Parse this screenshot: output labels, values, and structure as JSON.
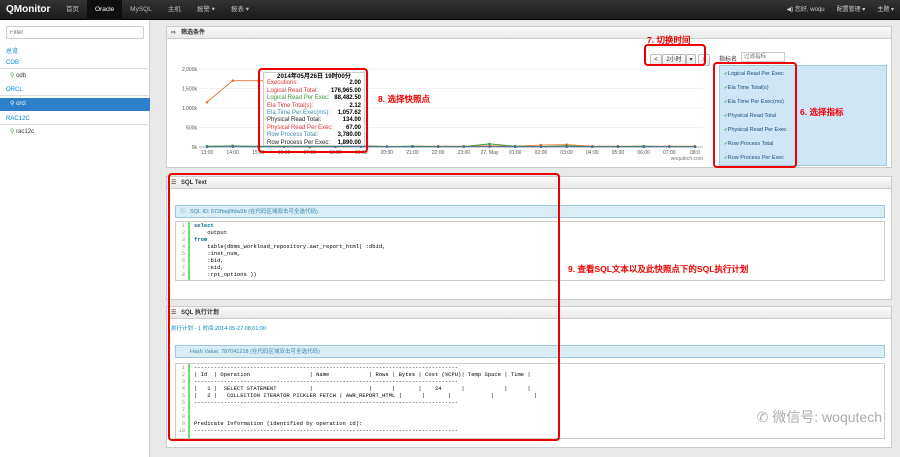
{
  "topbar": {
    "logo": "QMonitor",
    "nav": [
      "首页",
      "Oracle",
      "MySQL",
      "主机",
      "报警 ▾",
      "报表 ▾"
    ],
    "active": "Oracle",
    "right": [
      "◀) 您好, woqu",
      "配置管理 ▾",
      "主题 ▾"
    ]
  },
  "sidebar": {
    "filter_placeholder": "Filter",
    "title": "总览",
    "groups": [
      {
        "name": "COB",
        "items": [
          "odb"
        ]
      },
      {
        "name": "ORCL",
        "items": [
          "orcl"
        ]
      },
      {
        "name": "RAC12C",
        "items": [
          "rac12c"
        ]
      }
    ]
  },
  "filter_panel": {
    "title": "筛选条件",
    "time_prev": "<",
    "time_range": "2小时",
    "time_menu": "▾",
    "time_next": ">",
    "metric_label": "指标名",
    "metric_filter_placeholder": "过滤指标",
    "metrics": [
      "Logical Read Per Exec",
      "Ela Time Total(s)",
      "Ela Time Per Exec(ms)",
      "Physical Read Total",
      "Physical Read Per Exec",
      "Row Process Total",
      "Row Process Per Exec"
    ]
  },
  "chart_data": {
    "type": "line",
    "y_ticks": [
      "2,000k",
      "1,500k",
      "1,000k",
      "500k",
      "0k"
    ],
    "ylim": [
      0,
      2000000
    ],
    "x_ticks": [
      "13:00",
      "14:00",
      "15:00",
      "16:00",
      "17:00",
      "18:00",
      "19:00",
      "20:00",
      "21:00",
      "22:00",
      "23:00",
      "27. May",
      "01:00",
      "02:00",
      "03:00",
      "04:00",
      "05:00",
      "06:00",
      "07:00",
      "08:0"
    ],
    "series": [
      {
        "color": "#e8742d",
        "values": [
          1150000,
          1700000,
          1700000,
          1700000,
          0,
          20000,
          30000,
          15000,
          20000,
          20000,
          20000,
          30000,
          20000,
          50000,
          60000,
          20000,
          20000,
          20000,
          20000,
          20000
        ]
      },
      {
        "color": "#3a9a3a",
        "values": [
          20000,
          30000,
          20000,
          20000,
          20000,
          10000,
          30000,
          10000,
          20000,
          10000,
          10000,
          80000,
          20000,
          10000,
          30000,
          10000,
          10000,
          20000,
          10000,
          10000
        ]
      },
      {
        "color": "#4a6fa5",
        "values": [
          5000,
          8000,
          5000,
          5000,
          5000,
          5000,
          8000,
          5000,
          5000,
          5000,
          5000,
          10000,
          5000,
          5000,
          8000,
          5000,
          5000,
          5000,
          5000,
          5000
        ]
      }
    ],
    "credit": "woqutech.com"
  },
  "tooltip": {
    "title": "2014年05月26日 19时00分",
    "rows": [
      {
        "k": "Executions:",
        "v": "2.00",
        "c": "#d33"
      },
      {
        "k": "Logical Read Total:",
        "v": "176,965.00",
        "c": "#d33"
      },
      {
        "k": "Logical Read Per Exec:",
        "v": "88,482.50",
        "c": "#3a9a3a"
      },
      {
        "k": "Ela Time Total(s):",
        "v": "2.12",
        "c": "#d33"
      },
      {
        "k": "Ela Time Per Exec(ms):",
        "v": "1,057.62",
        "c": "#3a87ad"
      },
      {
        "k": "Physical Read Total:",
        "v": "134.00",
        "c": "#222"
      },
      {
        "k": "Physical Read Per Exec:",
        "v": "67.00",
        "c": "#d33"
      },
      {
        "k": "Row Process Total:",
        "v": "3,780.00",
        "c": "#3a87ad"
      },
      {
        "k": "Row Process Per Exec:",
        "v": "1,890.00",
        "c": "#222"
      }
    ]
  },
  "sql_text": {
    "title": "SQL Text",
    "bar": "SQL ID: 572fbaj0fdw2b  (在代码区域双击可全选代码)",
    "lines": [
      "1",
      "2",
      "3",
      "4",
      "5",
      "6",
      "7",
      "8"
    ],
    "code": [
      "select",
      "    output",
      "from",
      "    table(dbms_workload_repository.awr_report_html( :dbid,",
      "    :inst_num,",
      "    :bid,",
      "    :eid,",
      "    :rpt_options ))"
    ]
  },
  "sql_plan": {
    "title": "SQL 执行计划",
    "subtitle": "执行计划 - 1 时间:2014-05-27 08:01:00",
    "bar": "Hash Value: 787041218  (在代码区域双击可全选代码)",
    "lines": [
      "1",
      "2",
      "3",
      "4",
      "5",
      "6",
      "7",
      "8",
      "9",
      "10"
    ],
    "code": [
      "--------------------------------------------------------------------------------",
      "| Id  | Operation                  | Name            | Rows | Bytes | Cost (%CPU)| Temp Space | Time |",
      "--------------------------------------------------------------------------------",
      "|   1 |  SELECT STATEMENT          |                 |      |       |    24      |            |      |",
      "|   2 |   COLLECTION ITERATOR PICKLER FETCH | AWR_REPORT_HTML |      |       |            |            |      |",
      "--------------------------------------------------------------------------------",
      "",
      "",
      "Predicate Information (identified by operation id):",
      "--------------------------------------------------------------------------------"
    ]
  },
  "annotations": {
    "a6": "6. 选择指标",
    "a7": "7. 切换时间",
    "a8": "8. 选择快照点",
    "a9": "9. 查看SQL文本以及此快照点下的SQL执行计划"
  },
  "watermark": "微信号: woqutech"
}
